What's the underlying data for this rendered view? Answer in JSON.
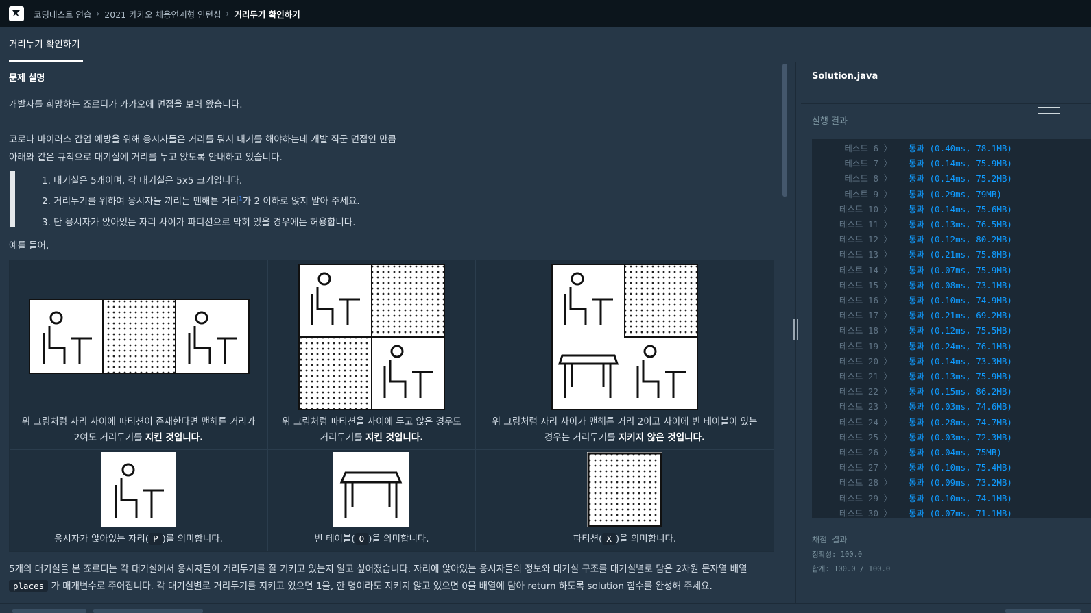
{
  "breadcrumb": {
    "items": [
      "코딩테스트 연습",
      "2021 카카오 채용연계형 인턴십"
    ],
    "current": "거리두기 확인하기"
  },
  "tab": {
    "label": "거리두기 확인하기"
  },
  "problem": {
    "heading": "문제 설명",
    "intro": "개발자를 희망하는 죠르디가 카카오에 면접을 보러 왔습니다.",
    "line2a": "코로나 바이러스 감염 예방을 위해 응시자들은 거리를 둬서 대기를 해야하는데 개발 직군 면접인 만큼",
    "line2b": "아래와 같은 규칙으로 대기실에 거리를 두고 앉도록 안내하고 있습니다.",
    "rules": [
      "1. 대기실은 5개이며, 각 대기실은 5x5 크기입니다.",
      "2. 거리두기를 위하여 응시자들 끼리는 맨해튼 거리",
      "3. 단 응시자가 앉아있는 자리 사이가 파티션으로 막혀 있을 경우에는 허용합니다."
    ],
    "rule2_sup": "1",
    "rule2_tail": "가 2 이하로 앉지 말아 주세요.",
    "example": "예를 들어,",
    "cap1a": "위 그림처럼 자리 사이에 파티션이 존재한다면 맨해튼 거리가",
    "cap1b": "2여도 거리두기를",
    "cap1bold": "지킨 것입니다.",
    "cap2a": "위 그림처럼 파티션을 사이에 두고 앉은 경우도",
    "cap2b": "거리두기를",
    "cap2bold": "지킨 것입니다.",
    "cap3a": "위 그림처럼 자리 사이가 맨해튼 거리 2이고 사이에 빈 테이블이 있는",
    "cap3b": "경우는 거리두기를",
    "cap3bold": "지키지 않은 것입니다.",
    "legend1a": "응시자가 앉아있는 자리(",
    "legend1code": "P",
    "legend1b": ")를 의미합니다.",
    "legend2a": "빈 테이블(",
    "legend2code": "O",
    "legend2b": ")을 의미합니다.",
    "legend3a": "파티션(",
    "legend3code": "X",
    "legend3b": ")을 의미합니다.",
    "bottom1": "5개의 대기실을 본 죠르디는 각 대기실에서 응시자들이 거리두기를 잘 기키고 있는지 알고 싶어졌습니다. 자리에 앉아있는 응시자들의 정보와 대기실 구조를 대기실별로 담은 2차원 문자열 배열",
    "bottom2code": "places",
    "bottom2": "가 매개변수로 주어집니다. 각 대기실별로 거리두기를 지키고 있으면 1을, 한 명이라도 지키지 않고 있으면 0을 배열에 담아 return 하도록 solution 함수를 완성해 주세요."
  },
  "editor": {
    "file": "Solution.java"
  },
  "result": {
    "title": "실행 결과",
    "tests": [
      {
        "label": "테스트 6 〉",
        "result": "통과 (0.40ms, 78.1MB)"
      },
      {
        "label": "테스트 7 〉",
        "result": "통과 (0.14ms, 75.9MB)"
      },
      {
        "label": "테스트 8 〉",
        "result": "통과 (0.14ms, 75.2MB)"
      },
      {
        "label": "테스트 9 〉",
        "result": "통과 (0.29ms, 79MB)"
      },
      {
        "label": "테스트 10 〉",
        "result": "통과 (0.14ms, 75.6MB)"
      },
      {
        "label": "테스트 11 〉",
        "result": "통과 (0.13ms, 76.5MB)"
      },
      {
        "label": "테스트 12 〉",
        "result": "통과 (0.12ms, 80.2MB)"
      },
      {
        "label": "테스트 13 〉",
        "result": "통과 (0.21ms, 75.8MB)"
      },
      {
        "label": "테스트 14 〉",
        "result": "통과 (0.07ms, 75.9MB)"
      },
      {
        "label": "테스트 15 〉",
        "result": "통과 (0.08ms, 73.1MB)"
      },
      {
        "label": "테스트 16 〉",
        "result": "통과 (0.10ms, 74.9MB)"
      },
      {
        "label": "테스트 17 〉",
        "result": "통과 (0.21ms, 69.2MB)"
      },
      {
        "label": "테스트 18 〉",
        "result": "통과 (0.12ms, 75.5MB)"
      },
      {
        "label": "테스트 19 〉",
        "result": "통과 (0.24ms, 76.1MB)"
      },
      {
        "label": "테스트 20 〉",
        "result": "통과 (0.14ms, 73.3MB)"
      },
      {
        "label": "테스트 21 〉",
        "result": "통과 (0.13ms, 75.9MB)"
      },
      {
        "label": "테스트 22 〉",
        "result": "통과 (0.15ms, 86.2MB)"
      },
      {
        "label": "테스트 23 〉",
        "result": "통과 (0.03ms, 74.6MB)"
      },
      {
        "label": "테스트 24 〉",
        "result": "통과 (0.28ms, 74.7MB)"
      },
      {
        "label": "테스트 25 〉",
        "result": "통과 (0.03ms, 72.3MB)"
      },
      {
        "label": "테스트 26 〉",
        "result": "통과 (0.04ms, 75MB)"
      },
      {
        "label": "테스트 27 〉",
        "result": "통과 (0.10ms, 75.4MB)"
      },
      {
        "label": "테스트 28 〉",
        "result": "통과 (0.09ms, 73.2MB)"
      },
      {
        "label": "테스트 29 〉",
        "result": "통과 (0.10ms, 74.1MB)"
      },
      {
        "label": "테스트 30 〉",
        "result": "통과 (0.07ms, 71.1MB)"
      }
    ],
    "score_title": "채점 결과",
    "accuracy": "정확성: 100.0",
    "total": "합계: 100.0 / 100.0"
  },
  "colors": {
    "background": "#263747",
    "topbar": "#0c151c",
    "pass": "#0f9bff"
  }
}
